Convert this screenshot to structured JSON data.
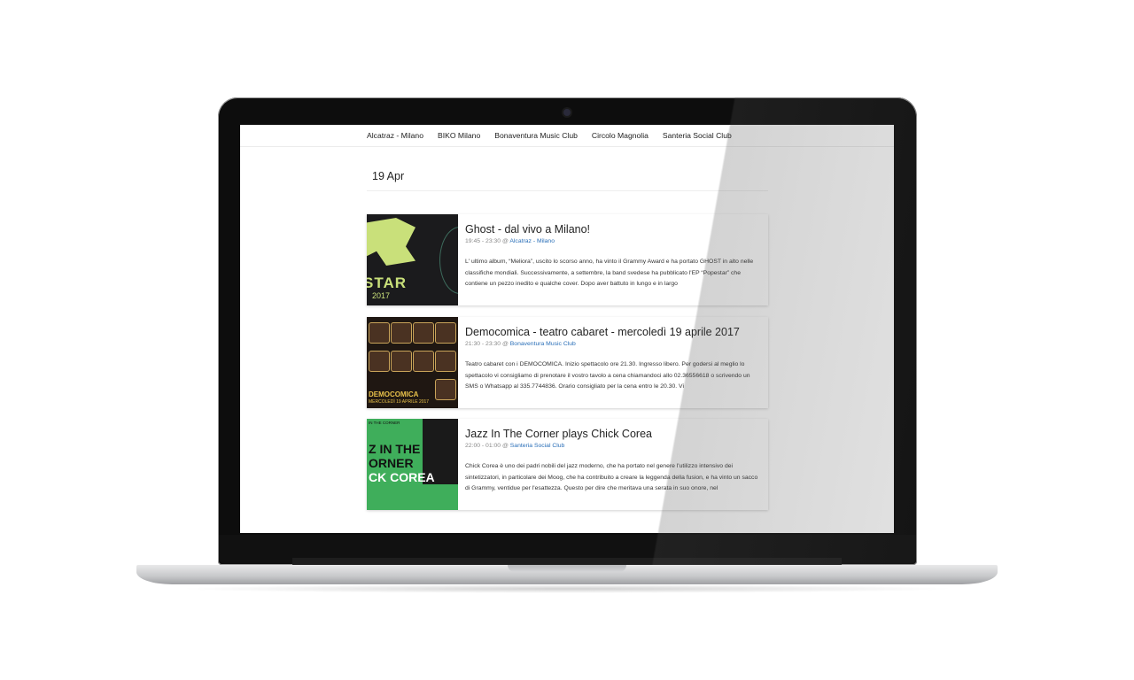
{
  "nav": {
    "items": [
      "Alcatraz - Milano",
      "BIKO Milano",
      "Bonaventura Music Club",
      "Circolo Magnolia",
      "Santeria Social Club"
    ]
  },
  "date_header": "19 Apr",
  "events": [
    {
      "title": "Ghost - dal vivo a Milano!",
      "time": "19:45 - 23:30 @",
      "venue": "Alcatraz - Milano",
      "description": "L' ultimo album, “Meliora”, uscito lo scorso anno, ha vinto il Grammy Award e ha portato GHOST in alto nelle classifiche mondiali. Successivamente, a settembre, la band svedese ha pubblicato l'EP “Popestar” che contiene un pezzo inedito e qualche cover. Dopo aver battuto in lungo e in largo",
      "thumb_text": "STAR",
      "thumb_sub": "2017"
    },
    {
      "title": "Democomica - teatro cabaret - mercoledì 19 aprile 2017",
      "time": "21:30 - 23:30 @",
      "venue": "Bonaventura Music Club",
      "description": "Teatro cabaret con i DEMOCOMICA. Inizio spettacolo ore 21.30. Ingresso libero. Per godersi al meglio lo spettacolo vi consigliamo di prenotare il vostro tavolo a cena chiamandoci allo 02.36556618 o scrivendo un SMS o Whatsapp al 335.7744836. Orario consigliato per la cena entro le 20.30. Vi",
      "thumb_text": "DEMOCOMICA",
      "thumb_sub": "MERCOLEDÌ 19 APRILE 2017"
    },
    {
      "title": "Jazz In The Corner plays Chick Corea",
      "time": "22:00 - 01:00 @",
      "venue": "Santeria Social Club",
      "description": "Chick Corea è uno dei padri nobili del jazz moderno, che ha portato nel genere l'utilizzo intensivo dei sintetizzatori, in particolare dei Moog, che ha contribuito a creare la leggenda della fusion, e ha vinto un sacco di Grammy, ventidue per l'esattezza. Questo per dire che meritava una serata in suo onore, nel",
      "thumb_lines": [
        "Z IN THE",
        "ORNER",
        "CK COREA"
      ],
      "thumb_top": "IN THE CORNER"
    }
  ]
}
